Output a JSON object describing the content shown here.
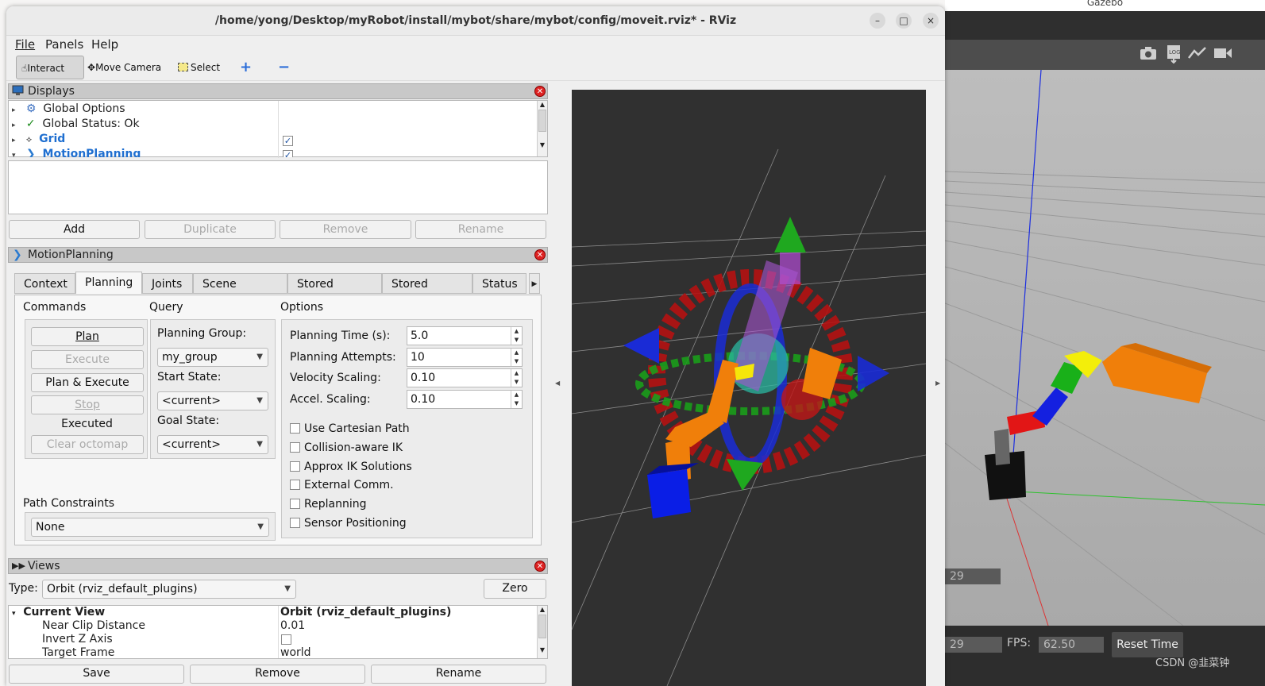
{
  "gazebo": {
    "window_title": "Gazebo",
    "toolbar_icons": [
      "camera-icon",
      "log-icon",
      "plot-icon",
      "video-icon"
    ],
    "sim_time_partial": "29",
    "fps_label": "FPS:",
    "fps_value": "62.50",
    "reset_time_label": "Reset Time",
    "watermark": "CSDN @韭菜钟"
  },
  "window": {
    "title": "/home/yong/Desktop/myRobot/install/mybot/share/mybot/config/moveit.rviz* - RViz",
    "controls": [
      "–",
      "□",
      "×"
    ]
  },
  "menu": [
    "File",
    "Panels",
    "Help"
  ],
  "toolbar": {
    "interact": "Interact",
    "move_camera": "Move Camera",
    "select": "Select",
    "plus": "+",
    "minus": "−"
  },
  "displays": {
    "title": "Displays",
    "items": [
      {
        "label": "Global Options",
        "icon": "gear-icon",
        "checked": null
      },
      {
        "label": "Global Status: Ok",
        "icon": "check-icon",
        "checked": null
      },
      {
        "label": "Grid",
        "icon": "grid-icon",
        "checked": true
      },
      {
        "label": "MotionPlanning",
        "icon": "motion-planning-icon",
        "checked": true
      }
    ],
    "buttons": {
      "add": "Add",
      "duplicate": "Duplicate",
      "remove": "Remove",
      "rename": "Rename"
    }
  },
  "motion_planning": {
    "title": "MotionPlanning",
    "tabs": [
      "Context",
      "Planning",
      "Joints",
      "Scene Objects",
      "Stored Scenes",
      "Stored States",
      "Status"
    ],
    "selected_tab": "Planning",
    "commands": {
      "header": "Commands",
      "plan": "Plan",
      "execute": "Execute",
      "plan_execute": "Plan & Execute",
      "stop": "Stop",
      "status": "Executed",
      "clear_octomap": "Clear octomap"
    },
    "query": {
      "header": "Query",
      "planning_group_label": "Planning Group:",
      "planning_group": "my_group",
      "start_state_label": "Start State:",
      "start_state": "<current>",
      "goal_state_label": "Goal State:",
      "goal_state": "<current>"
    },
    "options": {
      "header": "Options",
      "planning_time_label": "Planning Time (s):",
      "planning_time": "5.0",
      "planning_attempts_label": "Planning Attempts:",
      "planning_attempts": "10",
      "velocity_scaling_label": "Velocity Scaling:",
      "velocity_scaling": "0.10",
      "accel_scaling_label": "Accel. Scaling:",
      "accel_scaling": "0.10",
      "checkboxes": [
        "Use Cartesian Path",
        "Collision-aware IK",
        "Approx IK Solutions",
        "External Comm.",
        "Replanning",
        "Sensor Positioning"
      ]
    },
    "path_constraints": {
      "label": "Path Constraints",
      "value": "None"
    }
  },
  "views": {
    "title": "Views",
    "type_label": "Type:",
    "type_value": "Orbit (rviz_default_plugins)",
    "zero": "Zero",
    "current_view_label": "Current View",
    "current_view_value": "Orbit (rviz_default_plugins)",
    "rows": [
      {
        "label": "Near Clip Distance",
        "value": "0.01"
      },
      {
        "label": "Invert Z Axis",
        "value": ""
      },
      {
        "label": "Target Frame",
        "value": "world"
      }
    ],
    "buttons": {
      "save": "Save",
      "remove": "Remove",
      "rename": "Rename"
    }
  },
  "colors": {
    "viewport_bg": "#303030",
    "arrow_green": "#1aa81a",
    "arrow_blue": "#1a2bd6",
    "ring_red": "#c21414",
    "link_orange": "#f07f0a",
    "link_yellow": "#f5e60a",
    "base_blue": "#0a1ee6"
  }
}
